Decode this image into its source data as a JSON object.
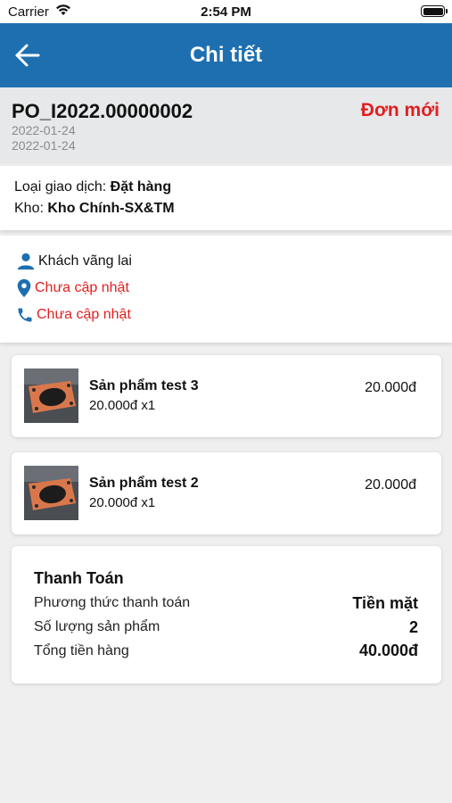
{
  "status_bar": {
    "carrier": "Carrier",
    "time": "2:54 PM"
  },
  "navbar": {
    "title": "Chi tiết",
    "back_icon": "arrow-left-icon"
  },
  "order": {
    "code": "PO_I2022.00000002",
    "status": "Đơn mới",
    "date_1": "2022-01-24",
    "date_2": "2022-01-24"
  },
  "info": {
    "transaction_label": "Loại giao dịch:",
    "transaction_value": "Đặt hàng",
    "warehouse_label": "Kho:",
    "warehouse_value": "Kho Chính-SX&TM"
  },
  "customer": {
    "name": "Khách vãng lai",
    "address": "Chưa cập nhật",
    "phone": "Chưa cập nhật"
  },
  "products": [
    {
      "name": "Sản phẩm test 3",
      "qty_line": "20.000đ x1",
      "total": "20.000đ"
    },
    {
      "name": "Sản phẩm test 2",
      "qty_line": "20.000đ x1",
      "total": "20.000đ"
    }
  ],
  "payment": {
    "title": "Thanh Toán",
    "method_label": "Phương thức thanh toán",
    "method_value": "Tiền mặt",
    "count_label": "Số lượng sản phẩm",
    "count_value": "2",
    "total_label": "Tổng tiền hàng",
    "total_value": "40.000đ"
  },
  "colors": {
    "primary": "#1e6fb0",
    "accent_red": "#e02020",
    "background": "#efeff0"
  }
}
